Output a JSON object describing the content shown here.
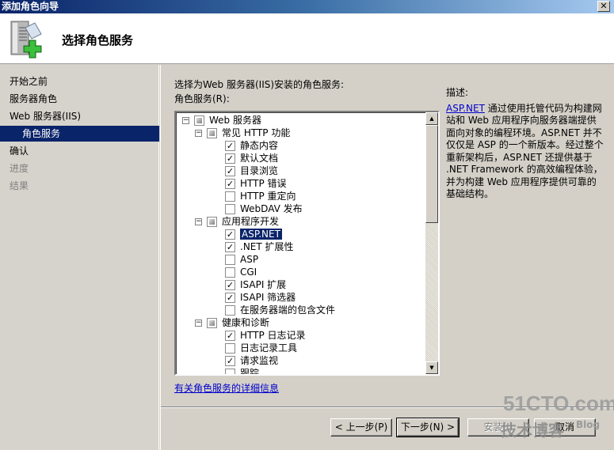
{
  "window": {
    "title": "添加角色向导",
    "close_label": "✕"
  },
  "header": {
    "icon": "server-add-icon",
    "title": "选择角色服务"
  },
  "sidebar": {
    "items": [
      {
        "label": "开始之前",
        "state": "normal"
      },
      {
        "label": "服务器角色",
        "state": "normal"
      },
      {
        "label": "Web 服务器(IIS)",
        "state": "normal"
      },
      {
        "label": "角色服务",
        "state": "active"
      },
      {
        "label": "确认",
        "state": "normal"
      },
      {
        "label": "进度",
        "state": "disabled"
      },
      {
        "label": "结果",
        "state": "disabled"
      }
    ]
  },
  "main": {
    "instruction": "选择为Web 服务器(IIS)安装的角色服务:",
    "tree_label": "角色服务(R):",
    "tree": [
      {
        "label": "Web 服务器",
        "level": 0,
        "expander": "−",
        "check": "partial"
      },
      {
        "label": "常见 HTTP 功能",
        "level": 1,
        "expander": "−",
        "check": "partial"
      },
      {
        "label": "静态内容",
        "level": 2,
        "check": "checked"
      },
      {
        "label": "默认文档",
        "level": 2,
        "check": "checked"
      },
      {
        "label": "目录浏览",
        "level": 2,
        "check": "checked"
      },
      {
        "label": "HTTP 错误",
        "level": 2,
        "check": "checked"
      },
      {
        "label": "HTTP 重定向",
        "level": 2,
        "check": "unchecked"
      },
      {
        "label": "WebDAV 发布",
        "level": 2,
        "check": "unchecked"
      },
      {
        "label": "应用程序开发",
        "level": 1,
        "expander": "−",
        "check": "partial"
      },
      {
        "label": "ASP.NET",
        "level": 2,
        "check": "checked",
        "selected": true
      },
      {
        "label": ".NET 扩展性",
        "level": 2,
        "check": "checked"
      },
      {
        "label": "ASP",
        "level": 2,
        "check": "unchecked"
      },
      {
        "label": "CGI",
        "level": 2,
        "check": "unchecked"
      },
      {
        "label": "ISAPI 扩展",
        "level": 2,
        "check": "checked"
      },
      {
        "label": "ISAPI 筛选器",
        "level": 2,
        "check": "checked"
      },
      {
        "label": "在服务器端的包含文件",
        "level": 2,
        "check": "unchecked"
      },
      {
        "label": "健康和诊断",
        "level": 1,
        "expander": "−",
        "check": "partial"
      },
      {
        "label": "HTTP 日志记录",
        "level": 2,
        "check": "checked"
      },
      {
        "label": "日志记录工具",
        "level": 2,
        "check": "unchecked"
      },
      {
        "label": "请求监视",
        "level": 2,
        "check": "checked"
      },
      {
        "label": "跟踪",
        "level": 2,
        "check": "unchecked"
      }
    ],
    "more_info_link": "有关角色服务的详细信息",
    "description": {
      "heading": "描述:",
      "link": "ASP.NET",
      "text": " 通过使用托管代码为构建网站和 Web 应用程序向服务器端提供面向对象的编程环境。ASP.NET 并不仅仅是 ASP 的一个新版本。经过整个重新架构后，ASP.NET 还提供基于 .NET Framework 的高效编程体验，并为构建 Web 应用程序提供可靠的基础结构。"
    }
  },
  "buttons": {
    "back": "< 上一步(P)",
    "next": "下一步(N) >",
    "install": "安装(I)",
    "cancel": "取消"
  },
  "watermark": {
    "line1": "51CTO.com",
    "line2": "技术博客",
    "line3": "Blog"
  }
}
